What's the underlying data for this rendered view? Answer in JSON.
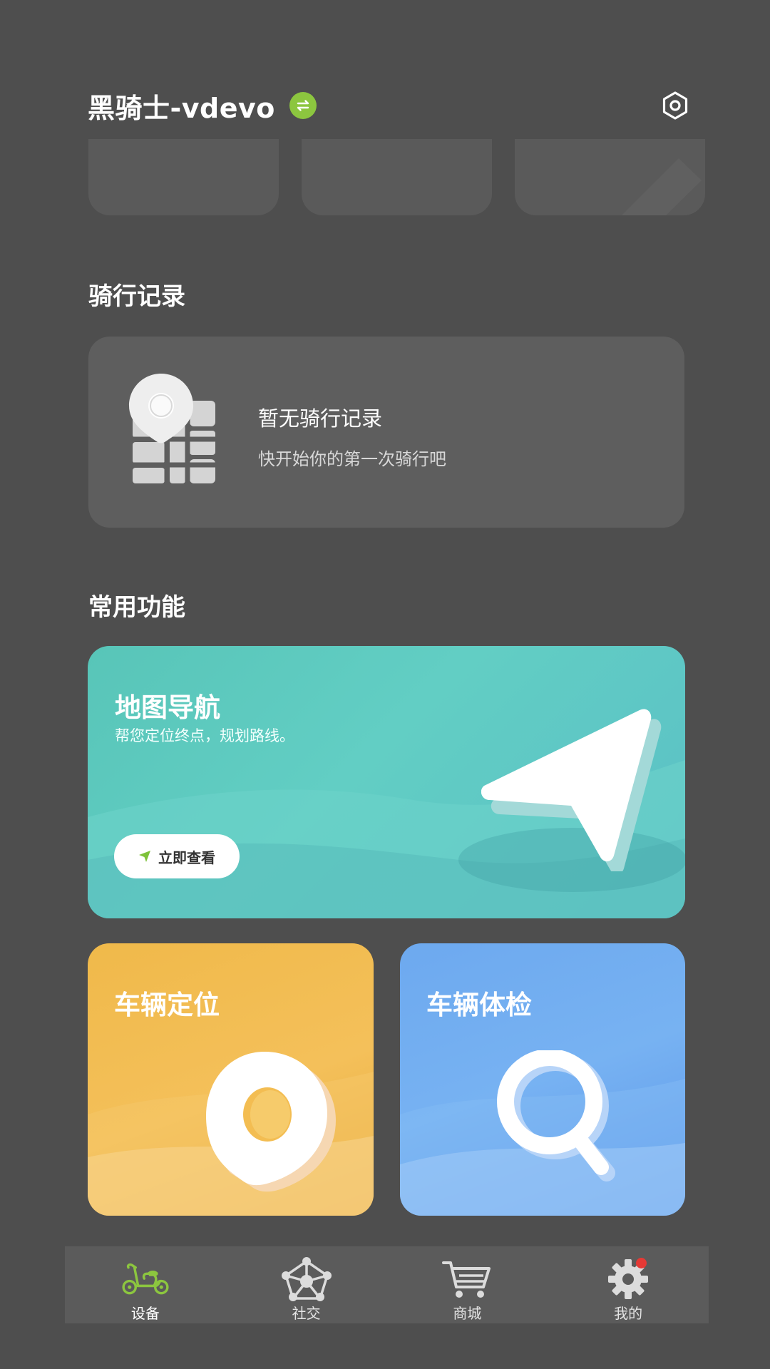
{
  "header": {
    "device_name": "黑骑士-vdevo",
    "switch_icon": "swap-icon",
    "settings_icon": "hexagon-settings-icon",
    "accent": "#8cc63f"
  },
  "ride_records": {
    "title": "骑行记录",
    "empty_title": "暂无骑行记录",
    "empty_subtitle": "快开始你的第一次骑行吧"
  },
  "features": {
    "title": "常用功能",
    "map_nav": {
      "title": "地图导航",
      "subtitle": "帮您定位终点，规划路线。",
      "button_label": "立即查看",
      "color": "#5fc9bf"
    },
    "vehicle_location": {
      "title": "车辆定位",
      "color": "#f2bb4f"
    },
    "vehicle_check": {
      "title": "车辆体检",
      "color": "#6fabf0"
    }
  },
  "tabbar": {
    "items": [
      {
        "label": "设备",
        "icon": "scooter-icon",
        "active": true
      },
      {
        "label": "社交",
        "icon": "network-icon"
      },
      {
        "label": "商城",
        "icon": "cart-icon"
      },
      {
        "label": "我的",
        "icon": "gear-icon",
        "badge": true
      }
    ],
    "active_color": "#8cc63f"
  }
}
